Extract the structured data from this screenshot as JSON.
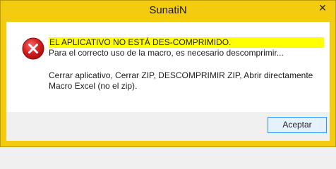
{
  "window": {
    "title": "SunatiN",
    "close_glyph": "✕",
    "accent_color": "#f3cb0f"
  },
  "dialog": {
    "icon": "error-icon",
    "headline": "EL APLICATIVO NO ESTÁ DES-COMPRIMIDO.",
    "line2": "Para el correcto uso de la macro, es necesario descomprimir...",
    "line3": "Cerrar aplicativo, Cerrar ZIP, DESCOMPRIMIR ZIP, Abrir directamente",
    "line4": "Macro Excel (no el zip).",
    "highlight_color": "#ffff00"
  },
  "buttons": {
    "ok_label": "Aceptar"
  }
}
